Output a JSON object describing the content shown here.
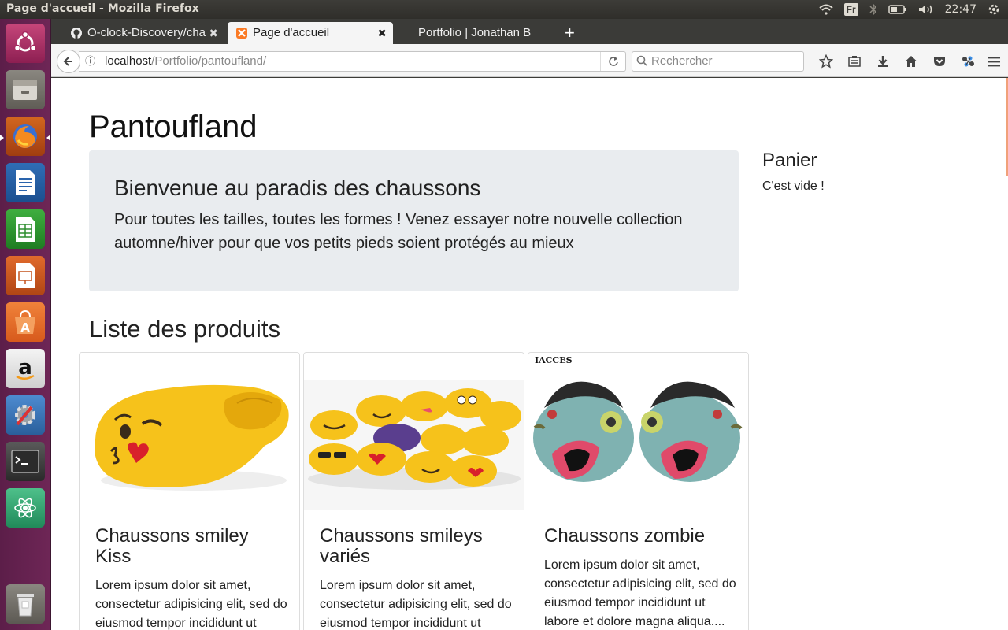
{
  "window": {
    "title": "Page d'accueil - Mozilla Firefox"
  },
  "tray": {
    "keyboard": "Fr",
    "clock": "22:47"
  },
  "tabs": [
    {
      "label": "O-clock-Discovery/cha",
      "icon": "github-icon"
    },
    {
      "label": "Page d'accueil",
      "icon": "xampp-icon"
    },
    {
      "label": "Portfolio | Jonathan B"
    }
  ],
  "nav": {
    "url_host": "localhost",
    "url_path": "/Portfolio/pantoufland/",
    "search_placeholder": "Rechercher"
  },
  "page": {
    "site_title": "Pantoufland",
    "jumbotron": {
      "title": "Bienvenue au paradis des chaussons",
      "text": "Pour toutes les tailles, toutes les formes ! Venez essayer notre nouvelle collection automne/hiver pour que vos petits pieds soient protégés au mieux"
    },
    "products_heading": "Liste des produits",
    "cart": {
      "title": "Panier",
      "empty": "C'est vide !"
    },
    "products": [
      {
        "title": "Chaussons smiley Kiss",
        "desc": "Lorem ipsum dolor sit amet, consectetur adipisicing elit, sed do eiusmod tempor incididunt ut"
      },
      {
        "title": "Chaussons smileys variés",
        "desc": "Lorem ipsum dolor sit amet, consectetur adipisicing elit, sed do eiusmod tempor incididunt ut"
      },
      {
        "title": "Chaussons zombie",
        "desc": "Lorem ipsum dolor sit amet, consectetur adipisicing elit, sed do eiusmod tempor incididunt ut labore et dolore magna aliqua....",
        "watermark": "IACCES"
      }
    ]
  }
}
